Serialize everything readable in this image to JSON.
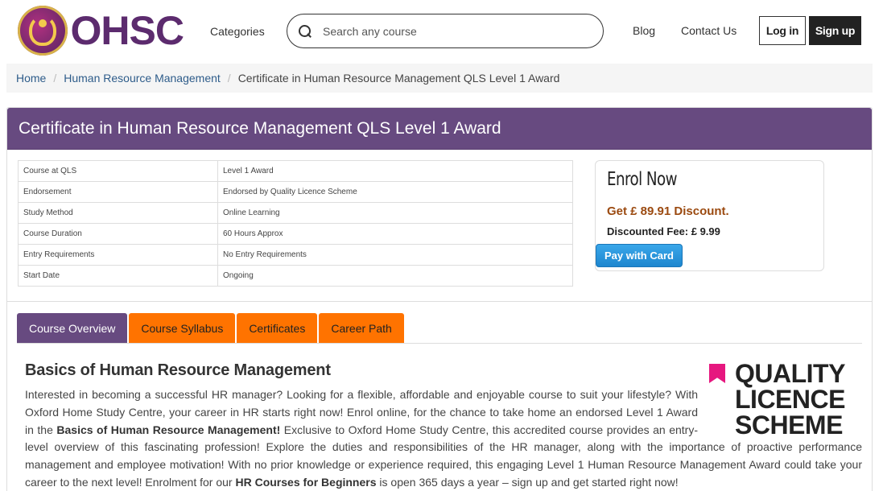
{
  "header": {
    "logo_text": "OHSC",
    "nav": {
      "categories": "Categories",
      "blog": "Blog",
      "contact": "Contact Us"
    },
    "search": {
      "placeholder": "Search any course"
    },
    "login_label": "Log in",
    "signup_label": "Sign up"
  },
  "breadcrumb": {
    "items": [
      "Home",
      "Human Resource Management"
    ],
    "current": "Certificate in Human Resource Management QLS Level 1 Award"
  },
  "course": {
    "title": "Certificate in Human Resource Management QLS Level 1 Award",
    "details": [
      {
        "key": "Course at QLS",
        "value": "Level 1 Award"
      },
      {
        "key": "Endorsement",
        "value": "Endorsed by Quality Licence Scheme"
      },
      {
        "key": "Study Method",
        "value": "Online Learning"
      },
      {
        "key": "Course Duration",
        "value": "60 Hours Approx"
      },
      {
        "key": "Entry Requirements",
        "value": "No Entry Requirements"
      },
      {
        "key": "Start Date",
        "value": "Ongoing"
      }
    ]
  },
  "enrol": {
    "title": "Enrol Now",
    "discount": "Get £ 89.91 Discount.",
    "fee": "Discounted Fee: £ 9.99",
    "pay_label": "Pay with Card"
  },
  "tabs": [
    {
      "label": "Course Overview",
      "active": true
    },
    {
      "label": "Course Syllabus",
      "active": false
    },
    {
      "label": "Certificates",
      "active": false
    },
    {
      "label": "Career Path",
      "active": false
    }
  ],
  "overview": {
    "heading": "Basics of Human Resource Management",
    "badge_lines": [
      "QUALITY",
      "LICENCE",
      "SCHEME"
    ],
    "p1": "Interested in becoming a successful HR manager?  Looking for a flexible, affordable and enjoyable course to suit your lifestyle?  With Oxford Home Study Centre, your career in HR starts right now!  Enrol online, for the chance to take home an endorsed Level 1 Award in the ",
    "p1_bold": "Basics of Human Resource Management!",
    "p2": "  Exclusive to Oxford Home Study Centre, this accredited course provides an entry-level overview of this fascinating profession!  Explore the duties and responsibilities of the HR manager, along with the importance of proactive performance management and employee motivation!  With no prior knowledge or experience required, this engaging Level 1 Human Resource Management Award could take your career to the next level!  Enrolment for our ",
    "p2_bold": "HR Courses for Beginners",
    "p3": " is open 365 days a year – sign up and get started right now!"
  },
  "colors": {
    "brand_purple": "#674a80",
    "tab_orange": "#ff7300",
    "discount_brown": "#9b4a10",
    "pay_blue": "#1d86cf",
    "qls_pink": "#e6177f"
  }
}
